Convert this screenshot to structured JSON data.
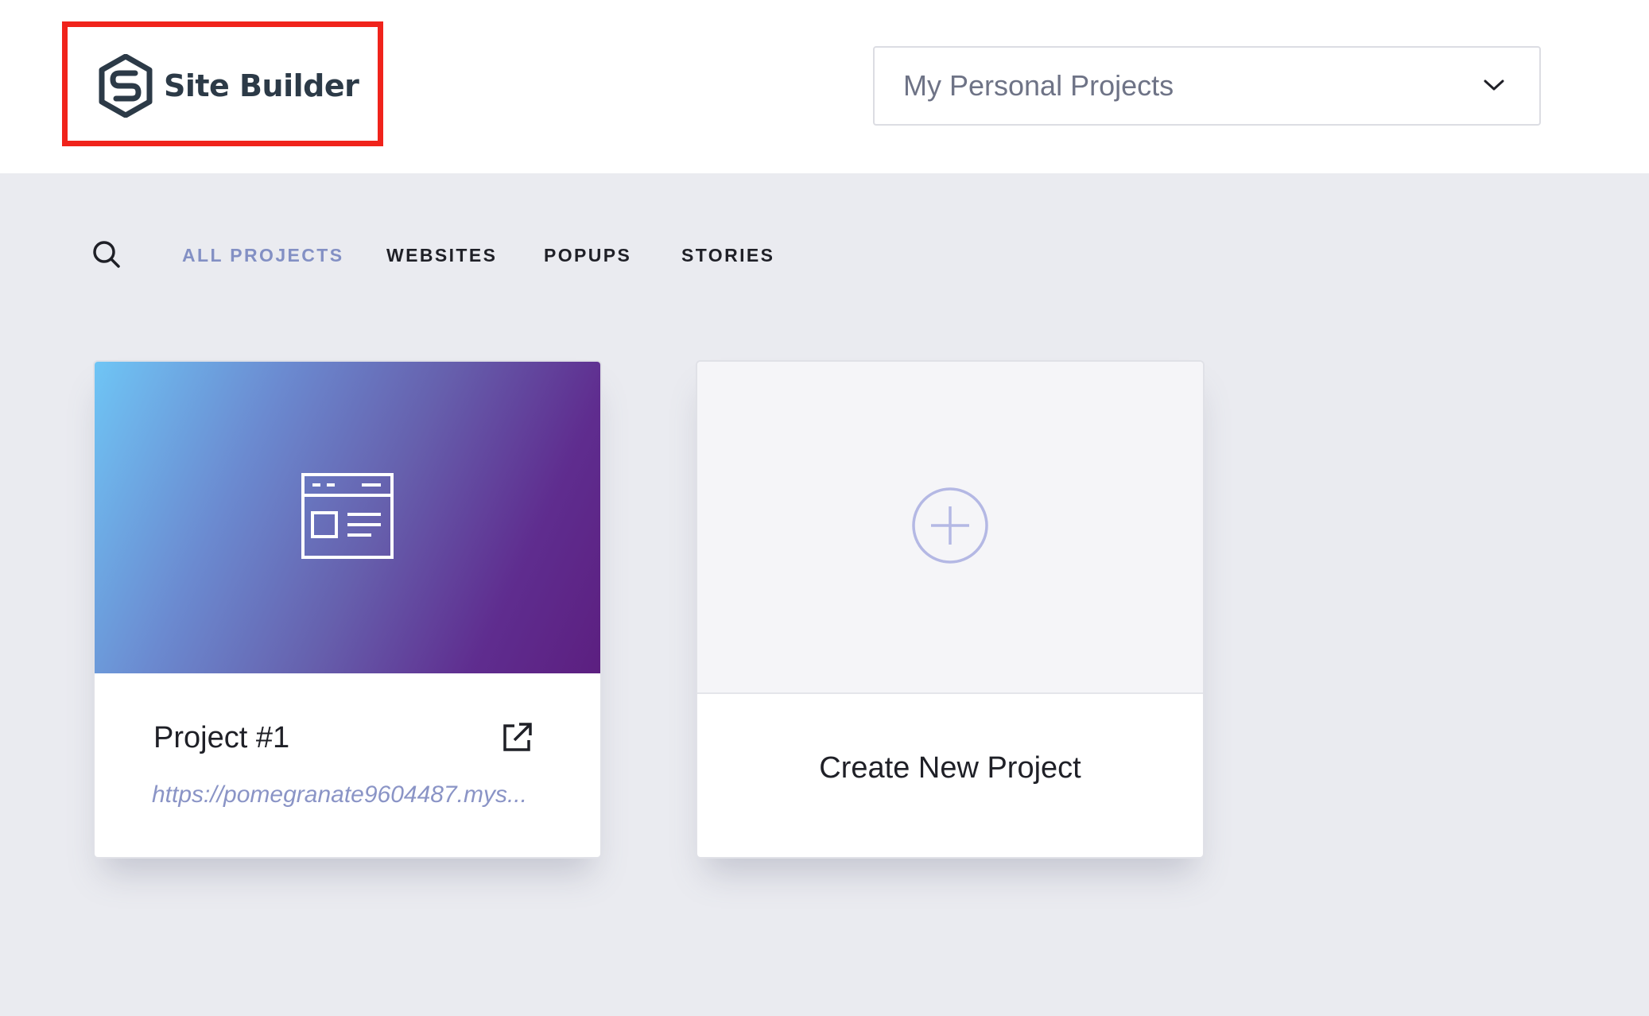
{
  "header": {
    "logo_text": "Site Builder",
    "logo_icon": "hexagon-s-logo-icon",
    "project_selector": {
      "value": "My Personal Projects",
      "icon": "chevron-down-icon"
    },
    "highlight_color": "#f0231b"
  },
  "filters": {
    "search_icon": "search-icon",
    "tabs": [
      {
        "label": "ALL PROJECTS",
        "active": true
      },
      {
        "label": "WEBSITES",
        "active": false
      },
      {
        "label": "POPUPS",
        "active": false
      },
      {
        "label": "STORIES",
        "active": false
      }
    ],
    "active_color": "#8390c4"
  },
  "projects": [
    {
      "title": "Project #1",
      "url": "https://pomegranate9604487.mys...",
      "thumbnail_icon": "website-layout-icon",
      "action_icon": "external-link-icon",
      "gradient": [
        "#6fc5f5",
        "#5c1f80"
      ]
    }
  ],
  "create_card": {
    "label": "Create New Project",
    "icon": "plus-circle-icon",
    "icon_color": "#b4b8e4"
  }
}
